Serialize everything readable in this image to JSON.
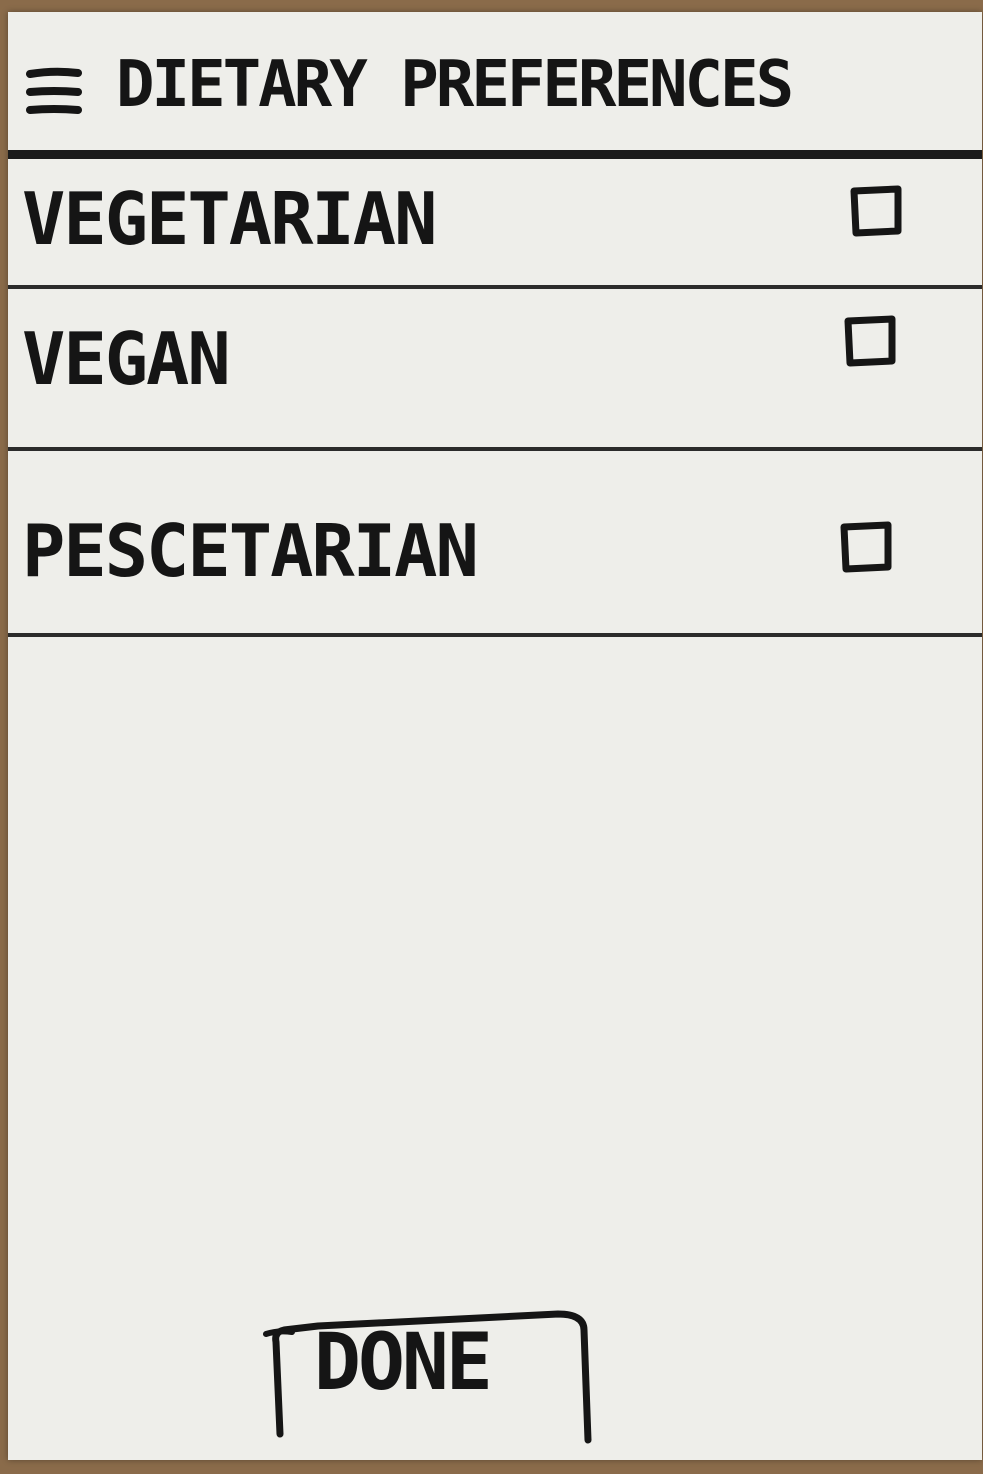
{
  "header": {
    "menu_icon": "hamburger-menu-icon",
    "title": "DIETARY PREFERENCES"
  },
  "options": [
    {
      "label": "VEGETARIAN",
      "checked": false
    },
    {
      "label": "VEGAN",
      "checked": false
    },
    {
      "label": "PESCETARIAN",
      "checked": false
    }
  ],
  "footer": {
    "done_label": "DONE"
  },
  "colors": {
    "paper": "#eeeeea",
    "ink": "#151515",
    "background": "#8a6b4a"
  }
}
